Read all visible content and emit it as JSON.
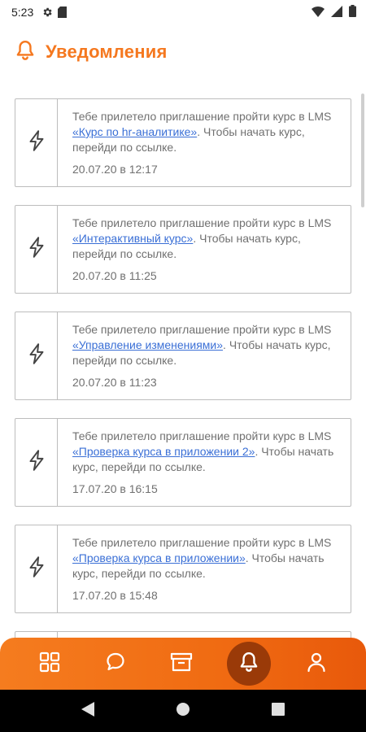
{
  "status_bar": {
    "time": "5:23"
  },
  "header": {
    "title": "Уведомления"
  },
  "notifications": [
    {
      "prefix": "Тебе прилетело приглашение пройти курс в LMS ",
      "link": "«Курс по hr-аналитике»",
      "suffix": ". Чтобы начать курс, перейди по ссылке.",
      "date": "20.07.20 в 12:17"
    },
    {
      "prefix": "Тебе прилетело приглашение пройти курс в LMS ",
      "link": "«Интерактивный курс»",
      "suffix": ". Чтобы начать курс, перейди по ссылке.",
      "date": "20.07.20 в 11:25"
    },
    {
      "prefix": "Тебе прилетело приглашение пройти курс в LMS ",
      "link": "«Управление изменениями»",
      "suffix": ". Чтобы начать курс, перейди по ссылке.",
      "date": "20.07.20 в 11:23"
    },
    {
      "prefix": "Тебе прилетело приглашение пройти курс в LMS ",
      "link": "«Проверка курса в приложении 2»",
      "suffix": ". Чтобы начать курс, перейди по ссылке.",
      "date": "17.07.20 в 16:15"
    },
    {
      "prefix": "Тебе прилетело приглашение пройти курс в LMS ",
      "link": "«Проверка курса в приложении»",
      "suffix": ". Чтобы начать курс, перейди по ссылке.",
      "date": "17.07.20 в 15:48"
    },
    {
      "prefix": "",
      "link": "",
      "suffix": "",
      "date": ""
    }
  ],
  "bottom_nav": {
    "items": [
      {
        "icon": "grid-icon",
        "active": false
      },
      {
        "icon": "chat-icon",
        "active": false
      },
      {
        "icon": "archive-icon",
        "active": false
      },
      {
        "icon": "bell-icon",
        "active": true
      },
      {
        "icon": "profile-icon",
        "active": false
      }
    ]
  },
  "colors": {
    "accent": "#f5781f",
    "link": "#3a6fd6",
    "text": "#707070",
    "border": "#bdbdbd"
  }
}
